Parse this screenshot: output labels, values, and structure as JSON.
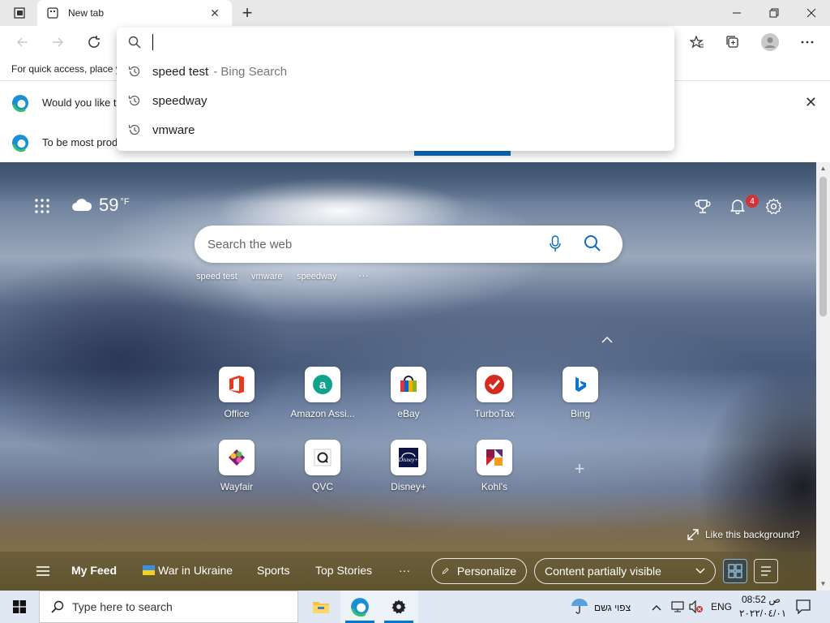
{
  "browser": {
    "tab_title": "New tab",
    "tab_close": "✕",
    "new_tab": "+",
    "window_controls": {
      "minimize": "—",
      "maximize": "❐",
      "close": "✕"
    }
  },
  "favorites_bar": {
    "text": "For quick access, place y"
  },
  "infobars": [
    {
      "text": "Would you like t",
      "close": "✕"
    },
    {
      "text": "To be most prod"
    }
  ],
  "omnibox": {
    "suggestions": [
      {
        "text": "speed test",
        "suffix": "- Bing Search"
      },
      {
        "text": "speedway",
        "suffix": ""
      },
      {
        "text": "vmware",
        "suffix": ""
      }
    ]
  },
  "ntp": {
    "weather": {
      "temp": "59",
      "unit": "°F"
    },
    "notifications_count": "4",
    "search_placeholder": "Search the web",
    "quick_links": [
      "speed test",
      "vmware",
      "speedway"
    ],
    "quick_links_more": "···",
    "tiles": [
      {
        "label": "Office",
        "icon": "office-icon"
      },
      {
        "label": "Amazon Assi...",
        "icon": "amazon-icon"
      },
      {
        "label": "eBay",
        "icon": "ebay-icon"
      },
      {
        "label": "TurboTax",
        "icon": "turbotax-icon"
      },
      {
        "label": "Bing",
        "icon": "bing-icon"
      },
      {
        "label": "Wayfair",
        "icon": "wayfair-icon"
      },
      {
        "label": "QVC",
        "icon": "qvc-icon"
      },
      {
        "label": "Disney+",
        "icon": "disney-icon"
      },
      {
        "label": "Kohl's",
        "icon": "kohls-icon"
      }
    ],
    "add_tile": "+",
    "like_background": "Like this background?",
    "feed": {
      "my_feed": "My Feed",
      "items": [
        "War in Ukraine",
        "Sports",
        "Top Stories"
      ],
      "more": "···",
      "personalize": "Personalize",
      "content_visibility": "Content partially visible"
    }
  },
  "taskbar": {
    "search_placeholder": "Type here to search",
    "weather_text": "צפוי גשם",
    "language": "ENG",
    "time": "08:52 ص",
    "date": "٢٠٢٢/٠٤/٠١"
  },
  "colors": {
    "accent": "#0f6cbd",
    "badge": "#d13438",
    "taskbar": "#dfe8f3"
  }
}
